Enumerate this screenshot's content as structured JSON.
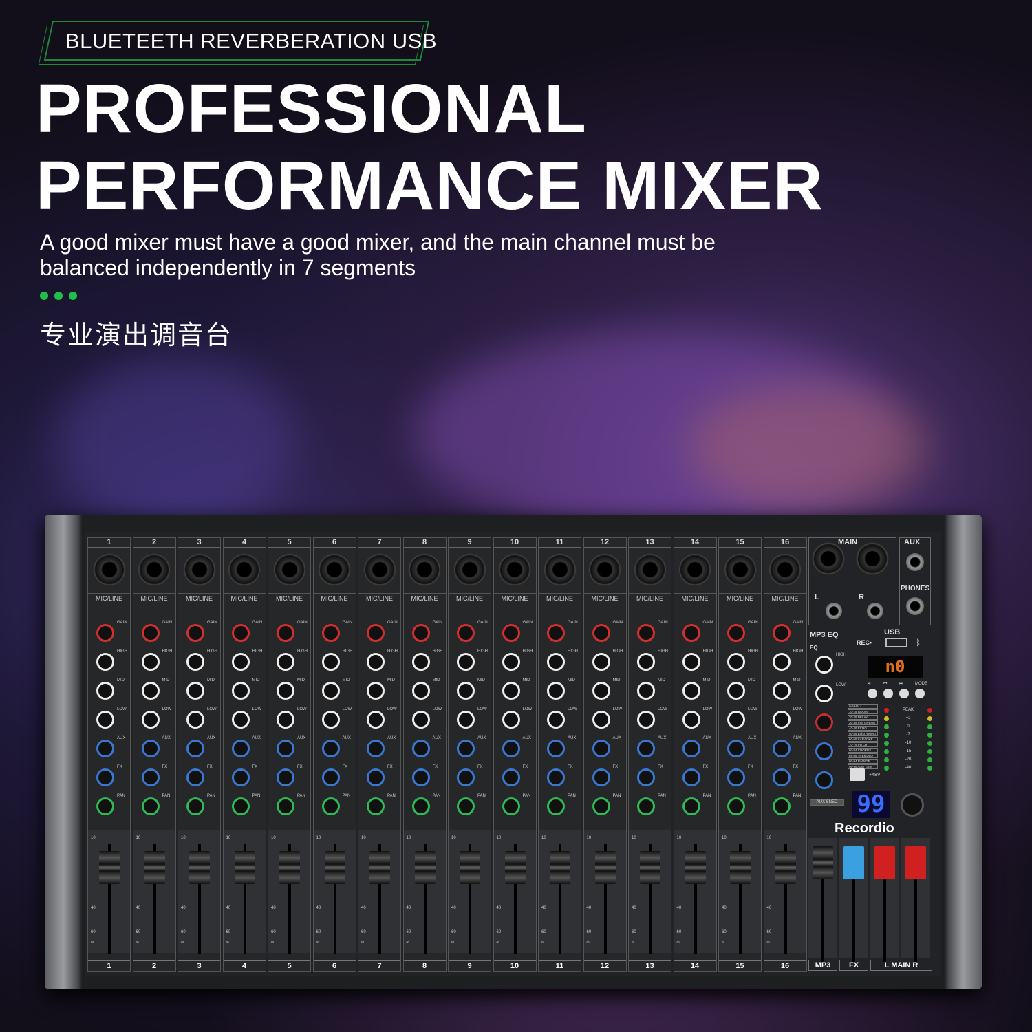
{
  "header": {
    "tag": "BLUETEETH REVERBERATION USB",
    "title_line1": "PROFESSIONAL",
    "title_line2": "PERFORMANCE MIXER",
    "subtitle": "A good mixer must have a good mixer, and the main channel must be balanced independently in 7 segments",
    "chinese_title": "专业演出调音台"
  },
  "mixer": {
    "channels": [
      "1",
      "2",
      "3",
      "4",
      "5",
      "6",
      "7",
      "8",
      "9",
      "10",
      "11",
      "12",
      "13",
      "14",
      "15",
      "16"
    ],
    "input_label": "MIC/LINE",
    "knob_labels": [
      "GAIN",
      "HIGH",
      "MID",
      "LOW",
      "AUX",
      "FX",
      "PAN"
    ],
    "knob_colors": [
      "#d23030",
      "#eeeeee",
      "#eeeeee",
      "#eeeeee",
      "#3a78d0",
      "#3a78d0",
      "#2fb855"
    ],
    "fader_scale": [
      "10",
      "40",
      "60",
      "∞"
    ],
    "main_label": "MAIN",
    "aux_label": "AUX",
    "phones_label": "PHONES",
    "left": "L",
    "right": "R",
    "usb_label": "USB",
    "rec_label": "REC•",
    "mp3_eq_label": "MP3 EQ",
    "eq_label": "EQ",
    "high": "HIGH",
    "low": "LOW",
    "mp3_display": "n0",
    "transport": [
      "⏯",
      "⏮",
      "⏭",
      "MODE"
    ],
    "effects": [
      "0-9 HALL",
      "10-19 ROOM",
      "20-29 DELAY",
      "30-39 PIM OPENG",
      "40-49 ECHO",
      "50-59 Echo Reverb",
      "60-69 KARAOKE",
      "70-79 PITCH",
      "80-84 CHORUS",
      "85-89 TREMOLO",
      "90-94 FLANGE",
      "95-99 Auto Tune"
    ],
    "meter_levels": [
      "PEAK",
      "+2",
      "0",
      "-7",
      "-10",
      "-15",
      "-20",
      "-40"
    ],
    "phantom_label": "+48V",
    "fx_display": "99",
    "aux_send_label": "AUX SNED",
    "brand": "Recordio",
    "bottom_labels": {
      "mp3": "MP3",
      "fx": "FX",
      "main": "L MAIN R"
    }
  }
}
